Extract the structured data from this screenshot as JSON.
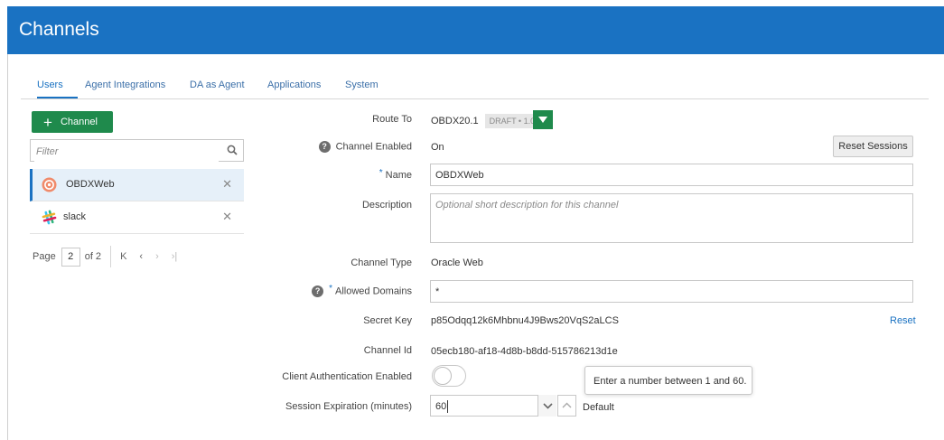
{
  "header": {
    "title": "Channels"
  },
  "tabs": [
    {
      "label": "Users",
      "active": true
    },
    {
      "label": "Agent Integrations"
    },
    {
      "label": "DA as Agent"
    },
    {
      "label": "Applications"
    },
    {
      "label": "System"
    }
  ],
  "sidebar": {
    "add_button_label": "Channel",
    "filter_placeholder": "Filter",
    "items": [
      {
        "label": "OBDXWeb",
        "icon": "oracle-web-icon",
        "selected": true
      },
      {
        "label": "slack",
        "icon": "slack-icon"
      }
    ],
    "pager": {
      "page_label": "Page",
      "current_page": "2",
      "of_label": "of 2"
    }
  },
  "form": {
    "route_to": {
      "label": "Route To",
      "value": "OBDX20.1",
      "badge": "DRAFT • 1.0"
    },
    "channel_enabled": {
      "label": "Channel Enabled",
      "value": "On"
    },
    "reset_sessions_label": "Reset Sessions",
    "name": {
      "label": "Name",
      "value": "OBDXWeb"
    },
    "description": {
      "label": "Description",
      "placeholder": "Optional short description for this channel"
    },
    "channel_type": {
      "label": "Channel Type",
      "value": "Oracle Web"
    },
    "allowed_domains": {
      "label": "Allowed Domains",
      "value": "*"
    },
    "secret_key": {
      "label": "Secret Key",
      "value": "p85Odqq12k6Mhbnu4J9Bws20VqS2aLCS",
      "reset_label": "Reset"
    },
    "channel_id": {
      "label": "Channel Id",
      "value": "05ecb180-af18-4d8b-b8dd-515786213d1e"
    },
    "client_auth": {
      "label": "Client Authentication Enabled",
      "enabled": false
    },
    "session_expiration": {
      "label": "Session Expiration (minutes)",
      "value": "60",
      "default_label": "Default"
    },
    "tooltip": "Enter a number between 1 and 60."
  },
  "colors": {
    "header": "#1a72c2",
    "primary_button": "#1f8a4c",
    "accent": "#1a72c2"
  }
}
